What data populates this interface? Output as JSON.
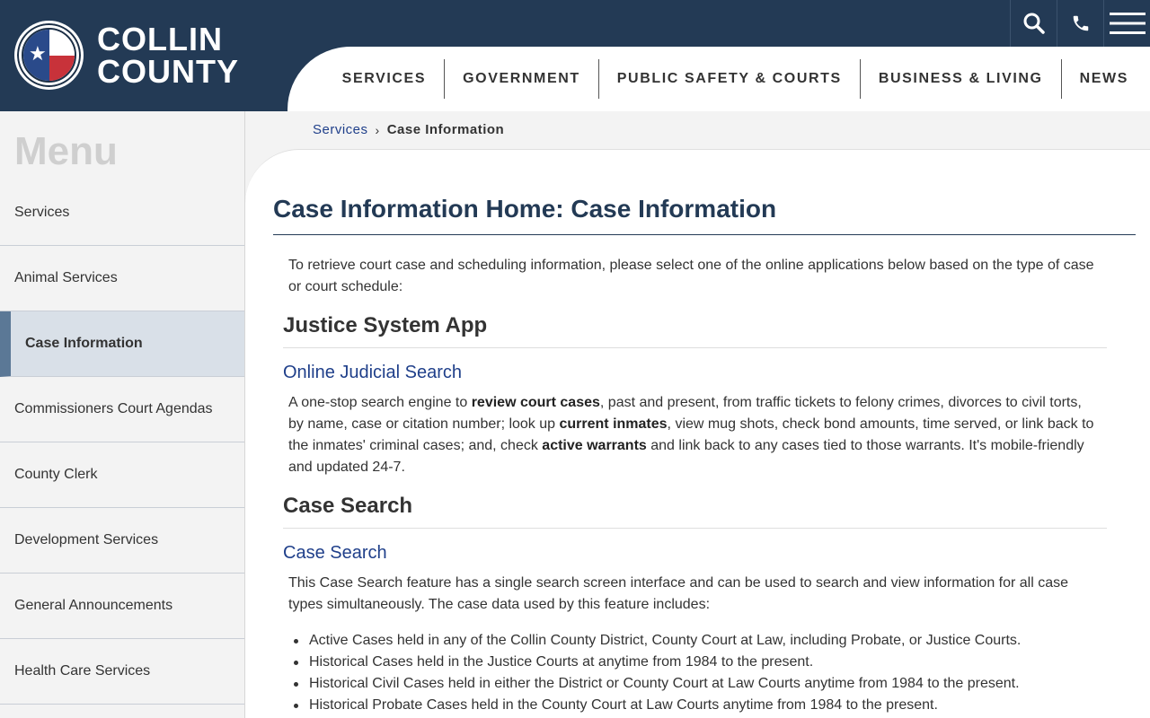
{
  "header": {
    "logo_line1": "COLLIN",
    "logo_line2": "COUNTY",
    "seal_text": "COLLIN COUNTY"
  },
  "nav": {
    "items": [
      "SERVICES",
      "GOVERNMENT",
      "PUBLIC SAFETY & COURTS",
      "BUSINESS & LIVING",
      "NEWS"
    ]
  },
  "sidebar": {
    "title": "Menu",
    "items": [
      "Services",
      "Animal Services",
      "Case Information",
      "Commissioners Court Agendas",
      "County Clerk",
      "Development Services",
      "General Announcements",
      "Health Care Services"
    ],
    "active_index": 2
  },
  "breadcrumb": {
    "link": "Services",
    "separator": "›",
    "current": "Case Information"
  },
  "main": {
    "title": "Case Information Home: Case Information",
    "intro": "To retrieve court case and scheduling information, please select one of the online applications below based on the type of case or court schedule:",
    "section1": {
      "heading": "Justice System App",
      "link": "Online Judicial Search",
      "p1": "A one-stop search engine to ",
      "b1": "review court cases",
      "p2": ", past and present, from traffic tickets to felony crimes, divorces to civil torts, by name, case or citation number; look up ",
      "b2": "current inmates",
      "p3": ", view mug shots, check bond amounts, time served, or link back to the inmates' criminal cases; and, check ",
      "b3": "active warrants",
      "p4": " and link back to any cases tied to those warrants. It's mobile-friendly and updated 24-7."
    },
    "section2": {
      "heading": "Case Search",
      "link": "Case Search",
      "text": "This Case Search feature has a single search screen interface and can be used to search and view information for all case types simultaneously. The case data used by this feature includes:",
      "bullets": [
        "Active Cases held in any of the Collin County District, County Court at Law, including Probate, or Justice Courts.",
        "Historical Cases held in the Justice Courts at anytime from 1984 to the present.",
        "Historical Civil Cases held in either the District or County Court at Law Courts anytime from 1984 to the present.",
        "Historical Probate Cases held in the County Court at Law Courts anytime from 1984 to the present."
      ]
    }
  }
}
